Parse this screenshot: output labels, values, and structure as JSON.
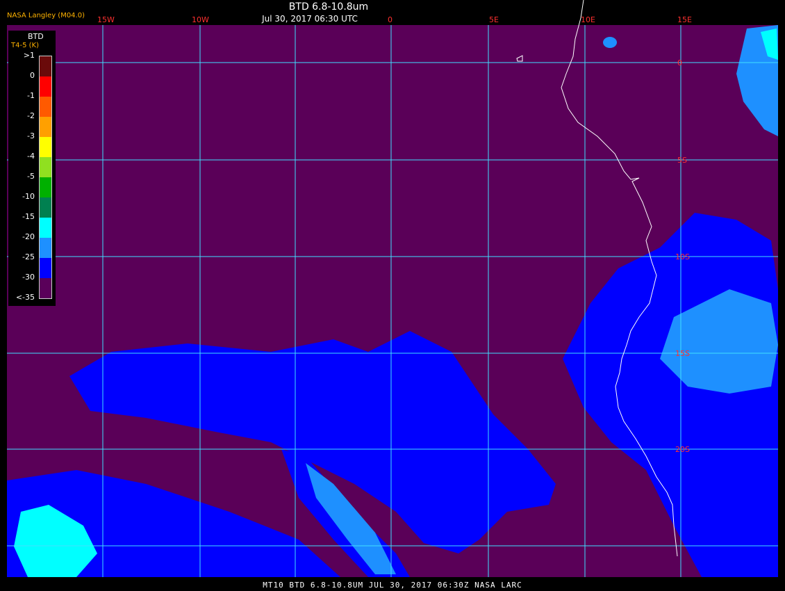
{
  "header": {
    "title": "BTD 6.8-10.8um",
    "subtitle": "Jul 30, 2017 06:30 UTC",
    "credit": "NASA Langley (M04.0)"
  },
  "footer": {
    "text": "MT10  BTD 6.8-10.8UM  JUL 30, 2017 06:30Z  NASA LARC"
  },
  "legend": {
    "title": "BTD",
    "subtitle": "T4-5 (K)",
    "labels": [
      ">1",
      "0",
      "-1",
      "-2",
      "-3",
      "-4",
      "-5",
      "-10",
      "-15",
      "-20",
      "-25",
      "-30",
      "<-35"
    ],
    "colors": [
      "#6a0a0a",
      "#ff0000",
      "#ff5a00",
      "#ffa000",
      "#ffff00",
      "#90e020",
      "#00b000",
      "#008050",
      "#00ffff",
      "#1e90ff",
      "#0000ff",
      "#5a005a"
    ]
  },
  "map": {
    "longitude_labels": [
      "15W",
      "10W",
      "0",
      "5E",
      "10E",
      "15E"
    ],
    "latitude_labels": [
      "0",
      "5S",
      "10S",
      "15S",
      "20S"
    ],
    "colors": {
      "background": "#5a0058",
      "grid": "#40e0ff",
      "lon_label": "#ff3030",
      "cloud_dark": "#0000ff",
      "cloud_mid": "#1e90ff",
      "cloud_light": "#00ffff",
      "coast": "#ffffff"
    }
  }
}
